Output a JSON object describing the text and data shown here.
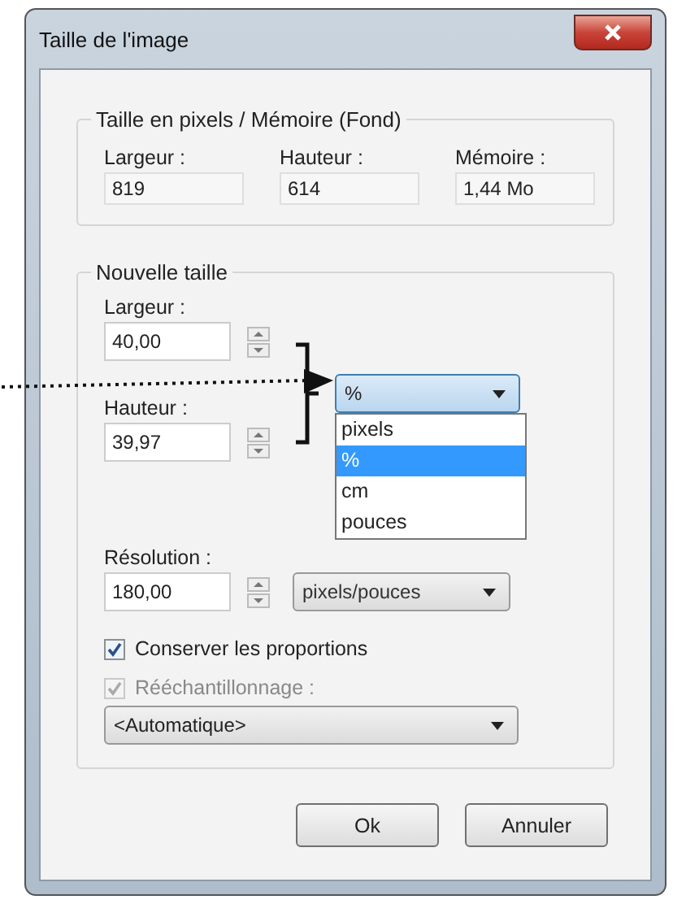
{
  "window": {
    "title": "Taille de l'image"
  },
  "pixel_size": {
    "title": "Taille en pixels / Mémoire (Fond)",
    "fields": [
      {
        "label": "Largeur :",
        "value": "819"
      },
      {
        "label": "Hauteur :",
        "value": "614"
      },
      {
        "label": "Mémoire :",
        "value": "1,44 Mo"
      }
    ]
  },
  "new_size": {
    "title": "Nouvelle taille",
    "width": {
      "label": "Largeur :",
      "value": "40,00"
    },
    "height": {
      "label": "Hauteur :",
      "value": "39,97"
    },
    "unit": {
      "value": "%",
      "expanded": true,
      "options": [
        {
          "label": "pixels",
          "selected": false
        },
        {
          "label": "%",
          "selected": true
        },
        {
          "label": "cm",
          "selected": false
        },
        {
          "label": "pouces",
          "selected": false
        }
      ]
    },
    "resolution": {
      "label": "Résolution :",
      "value": "180,00",
      "unit": "pixels/pouces"
    },
    "keep_proportions": {
      "label": "Conserver les proportions",
      "checked": true,
      "disabled": false
    },
    "resample": {
      "label": "Rééchantillonnage :",
      "checked": true,
      "disabled": true
    },
    "resample_method": "<Automatique>"
  },
  "buttons": [
    {
      "label": "Ok"
    },
    {
      "label": "Annuler"
    }
  ]
}
